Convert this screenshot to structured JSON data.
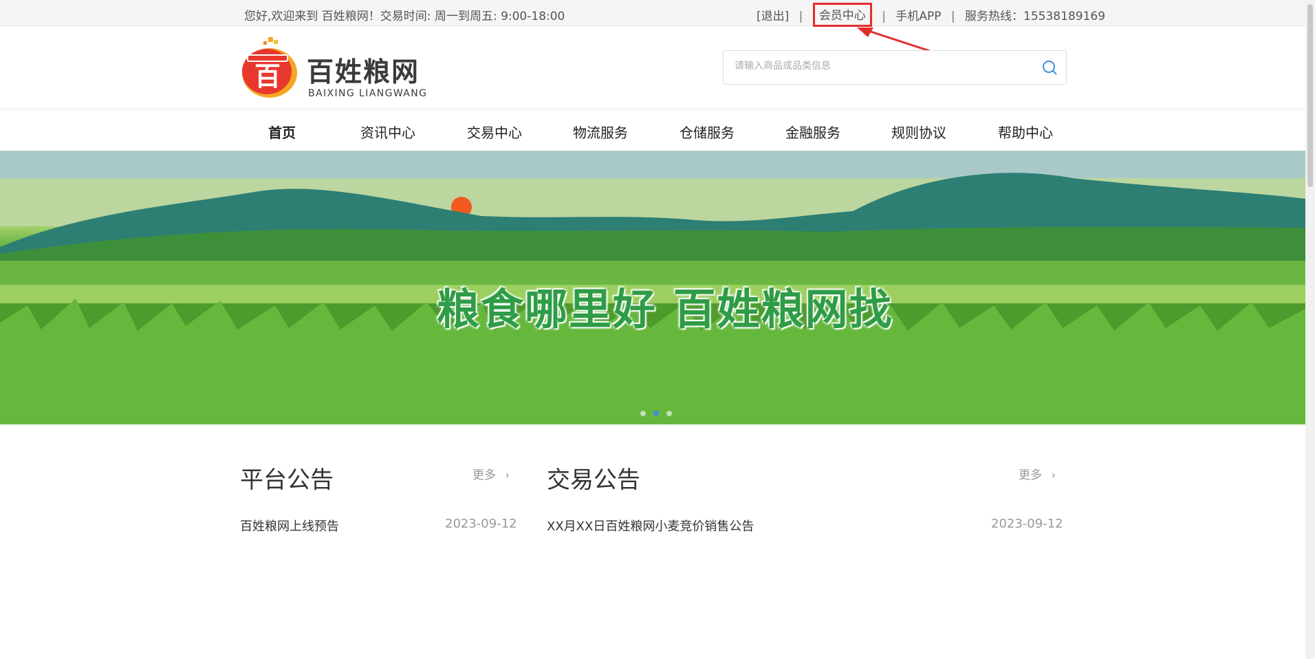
{
  "topbar": {
    "welcome": "您好,欢迎来到 百姓粮网！交易时间: 周一到周五: 9:00-18:00",
    "logout": "[退出]",
    "member_center": "会员中心",
    "mobile_app": "手机APP",
    "hotline": "服务热线：15538189169",
    "separator": "|"
  },
  "header": {
    "logo_title": "百姓粮网",
    "logo_subtitle": "BAIXING LIANGWANG",
    "logo_mark": "百",
    "search_placeholder": "请输入商品或品类信息"
  },
  "nav": {
    "items": [
      "首页",
      "资讯中心",
      "交易中心",
      "物流服务",
      "仓储服务",
      "金融服务",
      "规则协议",
      "帮助中心"
    ],
    "active": "首页"
  },
  "banner": {
    "slogan": "粮食哪里好 百姓粮网找",
    "slides": 3,
    "active_slide": 2
  },
  "platform_notice": {
    "title": "平台公告",
    "more": "更多",
    "items": [
      {
        "title": "百姓粮网上线预告",
        "date": "2023-09-12"
      }
    ]
  },
  "trade_notice": {
    "title": "交易公告",
    "more": "更多",
    "items": [
      {
        "title": "XX月XX日百姓粮网小麦竞价销售公告",
        "date": "2023-09-12"
      }
    ]
  },
  "colors": {
    "highlight_box": "#e32d2d",
    "slogan": "#2f9c47",
    "logo_red": "#e8372c",
    "logo_orange": "#f5a623"
  }
}
